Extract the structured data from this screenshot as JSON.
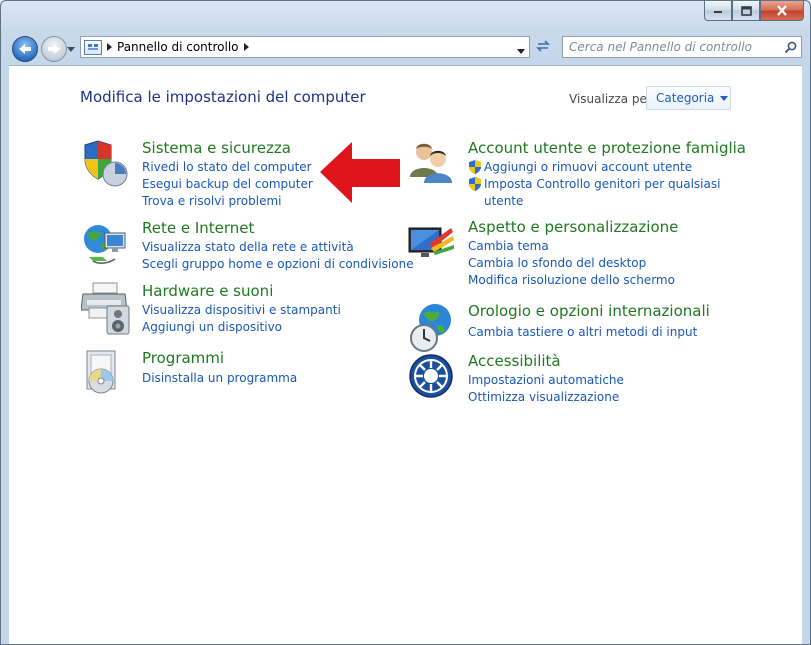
{
  "window": {
    "address": {
      "path": "Pannello di controllo"
    },
    "search": {
      "placeholder": "Cerca nel Pannello di controllo"
    }
  },
  "header": {
    "title": "Modifica le impostazioni del computer",
    "view_label": "Visualizza per:",
    "view_value": "Categoria"
  },
  "colors": {
    "category_title": "#1f7a1f",
    "link": "#1a58b8",
    "page_title": "#1e3287",
    "arrow": "#e0141b"
  },
  "categories": {
    "system": {
      "icon": "shield-icon",
      "title": "Sistema e sicurezza",
      "links": [
        "Rivedi lo stato del computer",
        "Esegui backup del computer",
        "Trova e risolvi problemi"
      ]
    },
    "network": {
      "icon": "network-globe-icon",
      "title": "Rete e Internet",
      "links": [
        "Visualizza stato della rete e attività",
        "Scegli gruppo home e opzioni di condivisione"
      ]
    },
    "hardware": {
      "icon": "printer-speaker-icon",
      "title": "Hardware e suoni",
      "links": [
        "Visualizza dispositivi e stampanti",
        "Aggiungi un dispositivo"
      ]
    },
    "programs": {
      "icon": "programs-disc-icon",
      "title": "Programmi",
      "links": [
        "Disinstalla un programma"
      ]
    },
    "accounts": {
      "icon": "users-icon",
      "title": "Account utente e protezione famiglia",
      "links": [
        "Aggiungi o rimuovi account utente",
        "Imposta Controllo genitori per qualsiasi",
        "utente"
      ]
    },
    "appearance": {
      "icon": "display-icon",
      "title": "Aspetto e personalizzazione",
      "links": [
        "Cambia tema",
        "Cambia lo sfondo del desktop",
        "Modifica risoluzione dello schermo"
      ]
    },
    "clock": {
      "icon": "clock-globe-icon",
      "title": "Orologio e opzioni internazionali",
      "links": [
        "Cambia tastiere o altri metodi di input"
      ]
    },
    "ease": {
      "icon": "accessibility-icon",
      "title": "Accessibilità",
      "links": [
        "Impostazioni automatiche",
        "Ottimizza visualizzazione"
      ]
    }
  }
}
